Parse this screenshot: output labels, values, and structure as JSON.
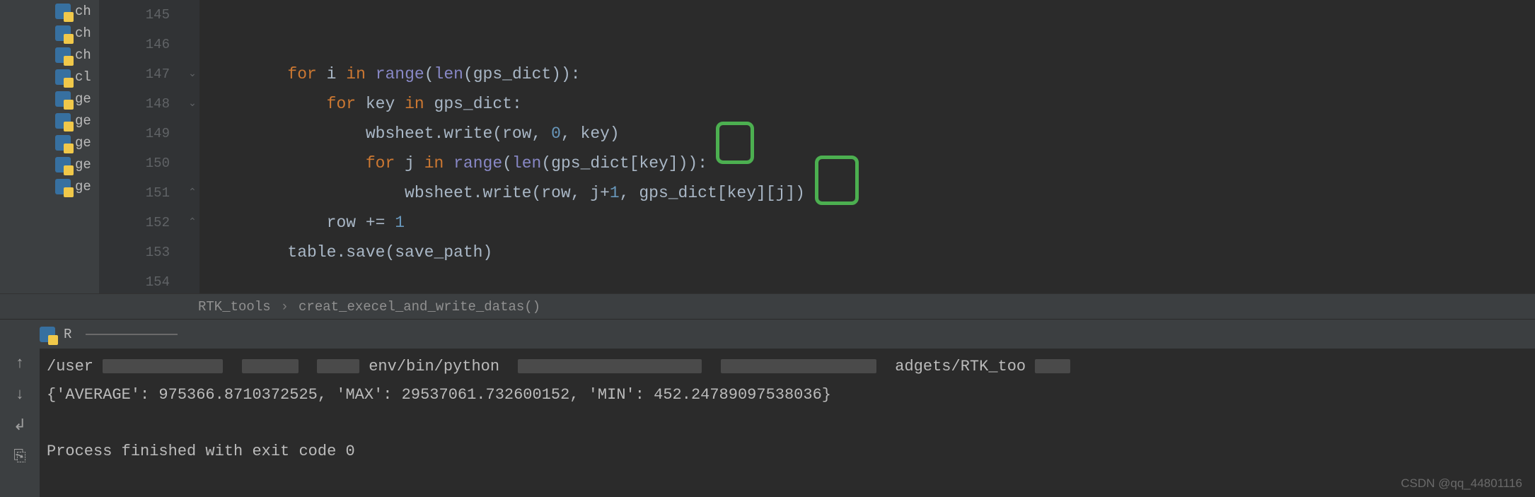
{
  "file_tree": {
    "items": [
      {
        "label": "ch"
      },
      {
        "label": "ch"
      },
      {
        "label": "ch"
      },
      {
        "label": "cl"
      },
      {
        "label": "ge"
      },
      {
        "label": "ge"
      },
      {
        "label": "ge"
      },
      {
        "label": "ge"
      },
      {
        "label": "ge"
      }
    ]
  },
  "gutter": {
    "lines": [
      "145",
      "146",
      "147",
      "148",
      "149",
      "150",
      "151",
      "152",
      "153",
      "154"
    ]
  },
  "code": {
    "lines": [
      {
        "indent": "",
        "tokens": []
      },
      {
        "indent": "",
        "tokens": []
      },
      {
        "indent": "        ",
        "tokens": [
          {
            "cls": "kw",
            "t": "for"
          },
          {
            "cls": "punct",
            "t": " "
          },
          {
            "cls": "ident",
            "t": "i"
          },
          {
            "cls": "punct",
            "t": " "
          },
          {
            "cls": "kw",
            "t": "in"
          },
          {
            "cls": "punct",
            "t": " "
          },
          {
            "cls": "fn",
            "t": "range"
          },
          {
            "cls": "punct",
            "t": "("
          },
          {
            "cls": "fn",
            "t": "len"
          },
          {
            "cls": "punct",
            "t": "(gps_dict)):"
          }
        ]
      },
      {
        "indent": "            ",
        "tokens": [
          {
            "cls": "kw",
            "t": "for"
          },
          {
            "cls": "punct",
            "t": " "
          },
          {
            "cls": "ident",
            "t": "key"
          },
          {
            "cls": "punct",
            "t": " "
          },
          {
            "cls": "kw",
            "t": "in"
          },
          {
            "cls": "punct",
            "t": " gps_dict:"
          }
        ]
      },
      {
        "indent": "                ",
        "tokens": [
          {
            "cls": "ident",
            "t": "wbsheet.write(row"
          },
          {
            "cls": "punct",
            "t": ", "
          },
          {
            "cls": "num",
            "t": "0"
          },
          {
            "cls": "punct",
            "t": ", "
          },
          {
            "cls": "ident",
            "t": "key)"
          }
        ]
      },
      {
        "indent": "                ",
        "tokens": [
          {
            "cls": "kw",
            "t": "for"
          },
          {
            "cls": "punct",
            "t": " "
          },
          {
            "cls": "ident",
            "t": "j"
          },
          {
            "cls": "punct",
            "t": " "
          },
          {
            "cls": "kw",
            "t": "in"
          },
          {
            "cls": "punct",
            "t": " "
          },
          {
            "cls": "fn",
            "t": "range"
          },
          {
            "cls": "punct",
            "t": "("
          },
          {
            "cls": "fn",
            "t": "len"
          },
          {
            "cls": "punct",
            "t": "(gps_dict[key])):"
          }
        ]
      },
      {
        "indent": "                    ",
        "tokens": [
          {
            "cls": "ident",
            "t": "wbsheet.write(row"
          },
          {
            "cls": "punct",
            "t": ", "
          },
          {
            "cls": "ident",
            "t": "j"
          },
          {
            "cls": "punct",
            "t": "+"
          },
          {
            "cls": "num",
            "t": "1"
          },
          {
            "cls": "punct",
            "t": ", "
          },
          {
            "cls": "ident",
            "t": "gps_dict[key][j])"
          }
        ]
      },
      {
        "indent": "            ",
        "tokens": [
          {
            "cls": "ident",
            "t": "row += "
          },
          {
            "cls": "num",
            "t": "1"
          }
        ]
      },
      {
        "indent": "        ",
        "tokens": [
          {
            "cls": "ident",
            "t": "table.save(save_path)"
          }
        ]
      },
      {
        "indent": "",
        "tokens": []
      }
    ]
  },
  "breadcrumb": {
    "parent": "RTK_tools",
    "current": "creat_execel_and_write_datas()"
  },
  "run": {
    "tab_prefix": "R"
  },
  "console": {
    "path_prefix": "/user",
    "path_mid1": "env/bin/python",
    "path_mid2": "adgets/RTK_too",
    "output_line": "{'AVERAGE': 975366.8710372525, 'MAX': 29537061.732600152, 'MIN': 452.24789097538036}",
    "exit_line": "Process finished with exit code 0"
  },
  "watermark": "CSDN @qq_44801116"
}
